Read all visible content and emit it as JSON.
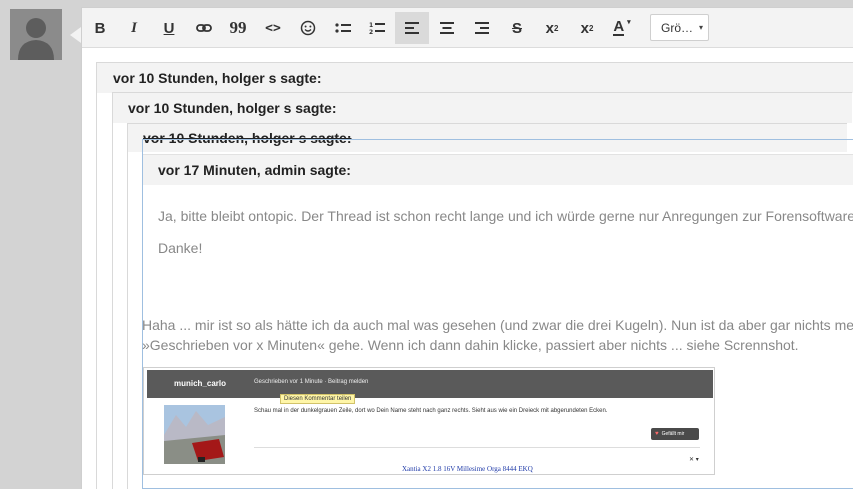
{
  "toolbar": {
    "buttons": [
      {
        "name": "bold",
        "glyph": "B"
      },
      {
        "name": "italic",
        "glyph": "I"
      },
      {
        "name": "underline",
        "glyph": "U"
      },
      {
        "name": "link"
      },
      {
        "name": "quote",
        "glyph": "99"
      },
      {
        "name": "code",
        "glyph": "<>"
      },
      {
        "name": "smiley"
      },
      {
        "name": "bullet-list"
      },
      {
        "name": "numbered-list"
      },
      {
        "name": "align-left"
      },
      {
        "name": "align-center"
      },
      {
        "name": "align-right"
      },
      {
        "name": "strikethrough",
        "glyph": "S"
      },
      {
        "name": "superscript",
        "glyph": "x",
        "mark": "2"
      },
      {
        "name": "subscript",
        "glyph": "x",
        "mark": "2"
      },
      {
        "name": "font-color",
        "glyph": "A"
      }
    ],
    "size_label": "Grö…"
  },
  "quotes": {
    "level1_header": "vor 10 Stunden, holger s sagte:",
    "level2_header": "vor 10 Stunden, holger s sagte:",
    "level3_header": "vor 10 Stunden, holger s sagte:",
    "level4_header": "vor 17 Minuten, admin sagte:",
    "level4_text1": "Ja, bitte bleibt ontopic. Der Thread ist schon recht lange und ich würde gerne nur Anregungen zur Forensoftware usw. lesen.",
    "level4_text2": "Danke!"
  },
  "reply": {
    "line1": "Haha ... mir ist so als hätte ich da auch mal was gesehen (und zwar die drei Kugeln). Nun ist da aber gar nichts mehr. Dafür kom",
    "line2": "»Geschrieben vor x Minuten« gehe. Wenn ich dann dahin klicke, passiert aber nichts ... siehe Scrennshot."
  },
  "screenshot": {
    "user": "munich_carlo",
    "meta": "Geschrieben vor 1 Minute · Beitrag melden",
    "tooltip": "Diesen Kommentar teilen",
    "message": "Schau mal in der dunkelgrauen Zeile, dort wo Dein Name steht nach ganz rechts. Sieht aus wie ein Dreieck mit abgerundeten Ecken.",
    "like_label": "Gefällt mir",
    "close_mark": "✕ ▾",
    "link_text": "Xantia X2 1.8 16V Millesime Orga 8444 EKQ"
  },
  "colors": {
    "toolbar_bg": "#f3f3f3",
    "quote_header_bg": "#f3f3f3",
    "active_quote_border": "#9fbfe0",
    "quote_text": "#888888"
  }
}
